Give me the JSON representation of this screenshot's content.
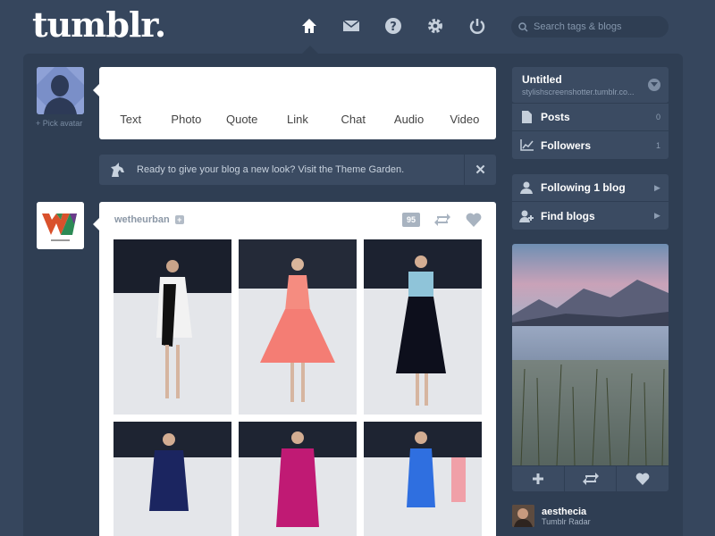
{
  "header": {
    "logo": "tumblr.",
    "nav": [
      {
        "name": "home-icon",
        "label": "Dashboard"
      },
      {
        "name": "mail-icon",
        "label": "Messages"
      },
      {
        "name": "help-icon",
        "label": "Help"
      },
      {
        "name": "settings-icon",
        "label": "Settings"
      },
      {
        "name": "power-icon",
        "label": "Log out"
      }
    ],
    "search_placeholder": "Search tags & blogs"
  },
  "composer": {
    "pick_avatar": "+ Pick avatar",
    "post_types": [
      "Text",
      "Photo",
      "Quote",
      "Link",
      "Chat",
      "Audio",
      "Video"
    ]
  },
  "theme_notice": {
    "text": "Ready to give your blog a new look? Visit the Theme Garden.",
    "close": "✕"
  },
  "post": {
    "username": "wetheurban",
    "notes": "95"
  },
  "sidebar": {
    "blog_title": "Untitled",
    "blog_url": "stylishscreenshotter.tumblr.co...",
    "stats": [
      {
        "label": "Posts",
        "count": "0"
      },
      {
        "label": "Followers",
        "count": "1"
      }
    ],
    "links": [
      {
        "label": "Following 1 blog"
      },
      {
        "label": "Find blogs"
      }
    ],
    "radar": {
      "user": "aesthecia",
      "caption": "Tumblr Radar"
    }
  },
  "colors": {
    "background": "#36465d",
    "panel": "#2f3e53",
    "card": "#ffffff"
  }
}
